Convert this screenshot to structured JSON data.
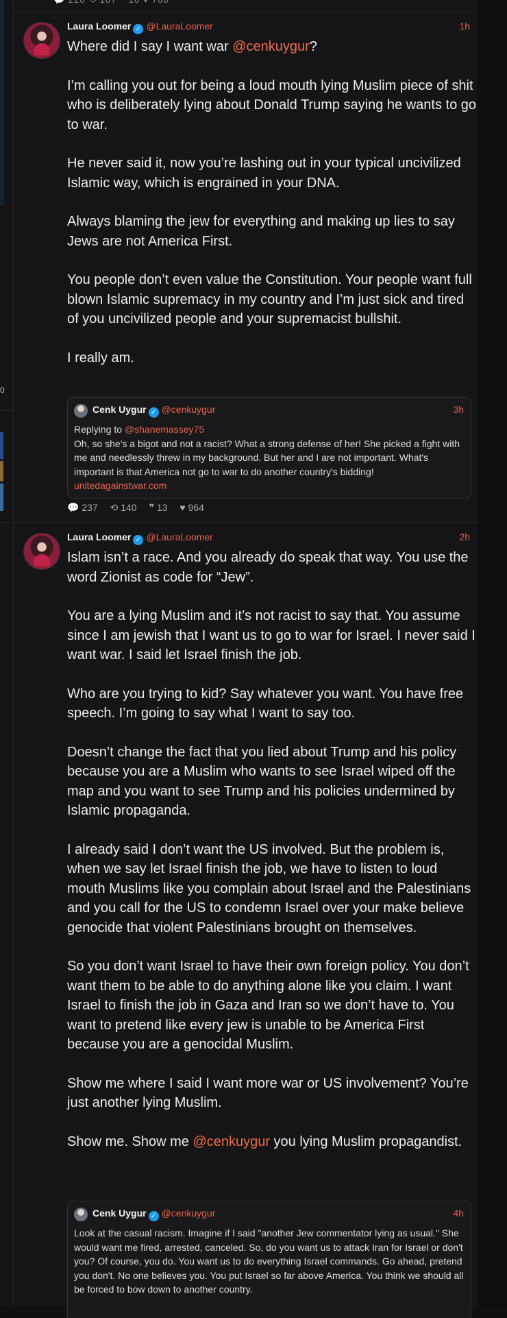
{
  "top_fragment": "💬 220   ⟲ 187   ❞ 16   ♥ 768",
  "sidebar": {
    "number": "0"
  },
  "posts": [
    {
      "author": "Laura Loomer",
      "handle": "@LauraLoomer",
      "time": "1h",
      "paragraphs": [
        {
          "pre": "Where did I say I want war ",
          "mention": "@cenkuygur",
          "post": "?"
        },
        {
          "pre": "I’m calling you out for being a loud mouth lying Muslim piece of shit who is deliberately lying about Donald Trump saying he wants to go to war.",
          "mention": "",
          "post": ""
        },
        {
          "pre": "He never said it, now you’re lashing out in your typical uncivilized Islamic way, which is engrained in your DNA.",
          "mention": "",
          "post": ""
        },
        {
          "pre": "Always blaming the jew for everything and making up lies to say Jews are not America First.",
          "mention": "",
          "post": ""
        },
        {
          "pre": "You people don’t even value the Constitution. Your people want full blown Islamic supremacy in my country and I’m just sick and tired of you uncivilized people and your supremacist bullshit.",
          "mention": "",
          "post": ""
        },
        {
          "pre": "I really am.",
          "mention": "",
          "post": ""
        }
      ],
      "quote": {
        "author": "Cenk Uygur",
        "handle": "@cenkuygur",
        "time": "3h",
        "replying_prefix": "Replying to ",
        "replying_to": "@shanemassey75",
        "text": "Oh, so she's a bigot and not a racist? What a strong defense of her! She picked a fight with me and needlessly threw in my background. But her and I are not important. What's important is that America not go to war to do another country's bidding! ",
        "link": "unitedagainstwar.com"
      },
      "stats": {
        "replies": "💬 237",
        "reposts": "⟲ 140",
        "quotes": "❞ 13",
        "likes": "♥ 964"
      }
    },
    {
      "author": "Laura Loomer",
      "handle": "@LauraLoomer",
      "time": "2h",
      "paragraphs": [
        {
          "pre": "Islam isn’t a race. And you already do speak that way. You use the word Zionist as code for “Jew”.",
          "mention": "",
          "post": ""
        },
        {
          "pre": "You are a lying Muslim and it’s not racist to say that. You assume since I am jewish that I want us to go to war for Israel. I never said I want war. I said let Israel finish the job.",
          "mention": "",
          "post": ""
        },
        {
          "pre": "Who are you trying to kid? Say whatever you want. You have free speech. I’m going to say what I want to say too.",
          "mention": "",
          "post": ""
        },
        {
          "pre": "Doesn’t change the fact that you lied about Trump and his policy because you are a Muslim who wants to see Israel wiped off the map and you want to see Trump and his policies undermined by Islamic propaganda.",
          "mention": "",
          "post": ""
        },
        {
          "pre": "I already said I don’t want the US involved. But the problem is, when we say let Israel finish the job, we have to listen to loud mouth Muslims like you complain about Israel and the Palestinians and you call for the US to condemn Israel over your make believe genocide that violent Palestinians brought on themselves.",
          "mention": "",
          "post": ""
        },
        {
          "pre": "So you don’t want Israel to have their own foreign policy. You don’t want them to be able to do anything alone like you claim. I want Israel to finish the job in Gaza and Iran so we don’t have to. You want to pretend like every jew is unable to be America First because you are a genocidal Muslim.",
          "mention": "",
          "post": ""
        },
        {
          "pre": "Show me where I said I want more war or US involvement? You’re just another lying Muslim.",
          "mention": "",
          "post": ""
        },
        {
          "pre": "Show me. Show me ",
          "mention": "@cenkuygur",
          "post": " you lying Muslim propagandist."
        }
      ],
      "quote": {
        "author": "Cenk Uygur",
        "handle": "@cenkuygur",
        "time": "4h",
        "text": "Look at the casual racism. Imagine if I said \"another Jew commentator lying as usual.\" She would want me fired, arrested, canceled. So, do you want us to attack Iran for Israel or don't you? Of course, you do. You want us to do everything Israel commands. Go ahead, pretend you don't. No one believes you. You put Israel so far above America. You think we should all be forced to bow down to another country."
      }
    }
  ]
}
